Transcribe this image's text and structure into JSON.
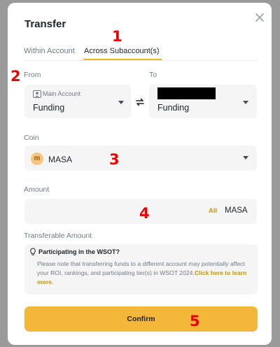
{
  "dialog": {
    "title": "Transfer"
  },
  "tabs": [
    {
      "label": "Within Account"
    },
    {
      "label": "Across Subaccount(s)"
    }
  ],
  "from": {
    "label": "From",
    "sub_label": "Main Account",
    "value": "Funding"
  },
  "to": {
    "label": "To",
    "value": "Funding"
  },
  "coin": {
    "label": "Coin",
    "value": "MASA",
    "icon_letter": "m"
  },
  "amount": {
    "label": "Amount",
    "all_label": "All",
    "unit": "MASA"
  },
  "transferable": {
    "label": "Transferable Amount",
    "info_title": "Participating in the WSOT?",
    "info_text": "Please note that transferring funds to a different account may potentially affect your ROI, rankings, and participating tier(s) in WSOT 2024.",
    "link_text": "Click here to learn more",
    "end": "."
  },
  "confirm_label": "Confirm",
  "annotations": [
    "1",
    "2",
    "3",
    "4",
    "5"
  ],
  "colors": {
    "accent": "#f0b90b",
    "button": "#f4b73a",
    "annotation": "#ee0000"
  }
}
